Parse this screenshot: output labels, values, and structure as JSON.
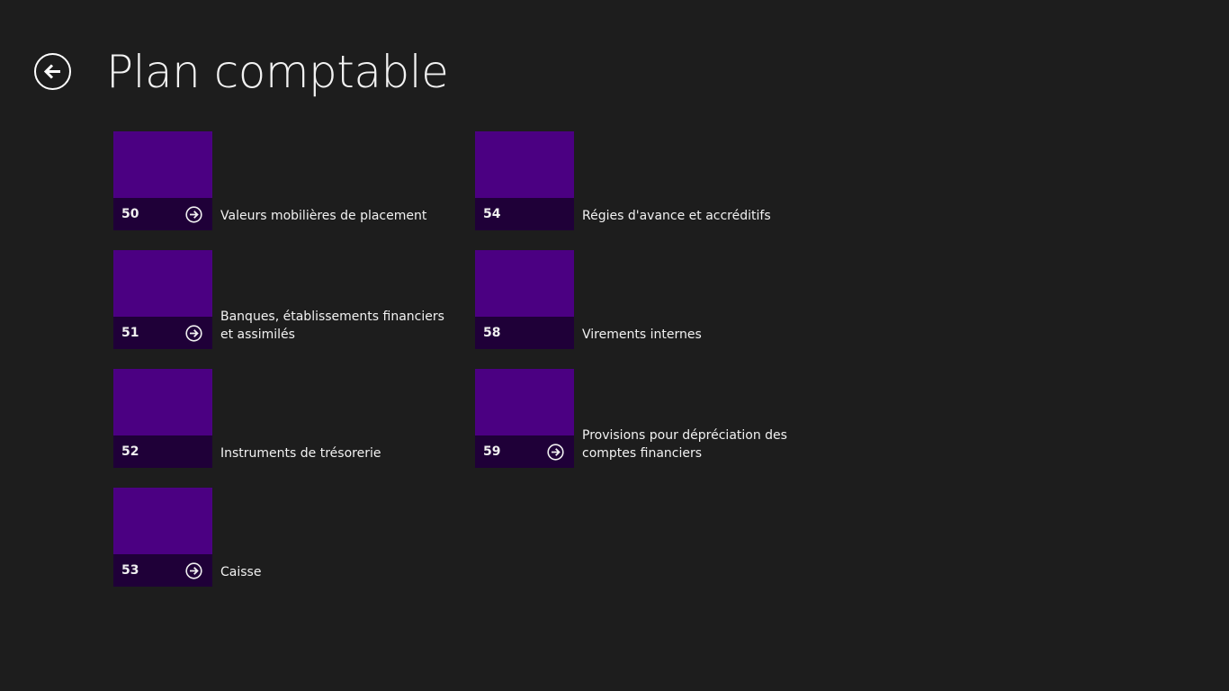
{
  "header": {
    "title": "Plan comptable",
    "back_icon": "back-arrow-icon"
  },
  "colors": {
    "background": "#1d1d1d",
    "tile": "#4b0082",
    "tile_footer": "#1f0038",
    "text": "#f2f2f2"
  },
  "columns": [
    {
      "items": [
        {
          "code": "50",
          "label": "Valeurs mobilières de placement",
          "has_arrow": true
        },
        {
          "code": "51",
          "label": "Banques, établissements financiers et assimilés",
          "has_arrow": true
        },
        {
          "code": "52",
          "label": "Instruments de trésorerie",
          "has_arrow": false
        },
        {
          "code": "53",
          "label": "Caisse",
          "has_arrow": true
        }
      ]
    },
    {
      "items": [
        {
          "code": "54",
          "label": "Régies d'avance et accréditifs",
          "has_arrow": false
        },
        {
          "code": "58",
          "label": "Virements internes",
          "has_arrow": false
        },
        {
          "code": "59",
          "label": "Provisions pour dépréciation des comptes financiers",
          "has_arrow": true
        }
      ]
    }
  ]
}
